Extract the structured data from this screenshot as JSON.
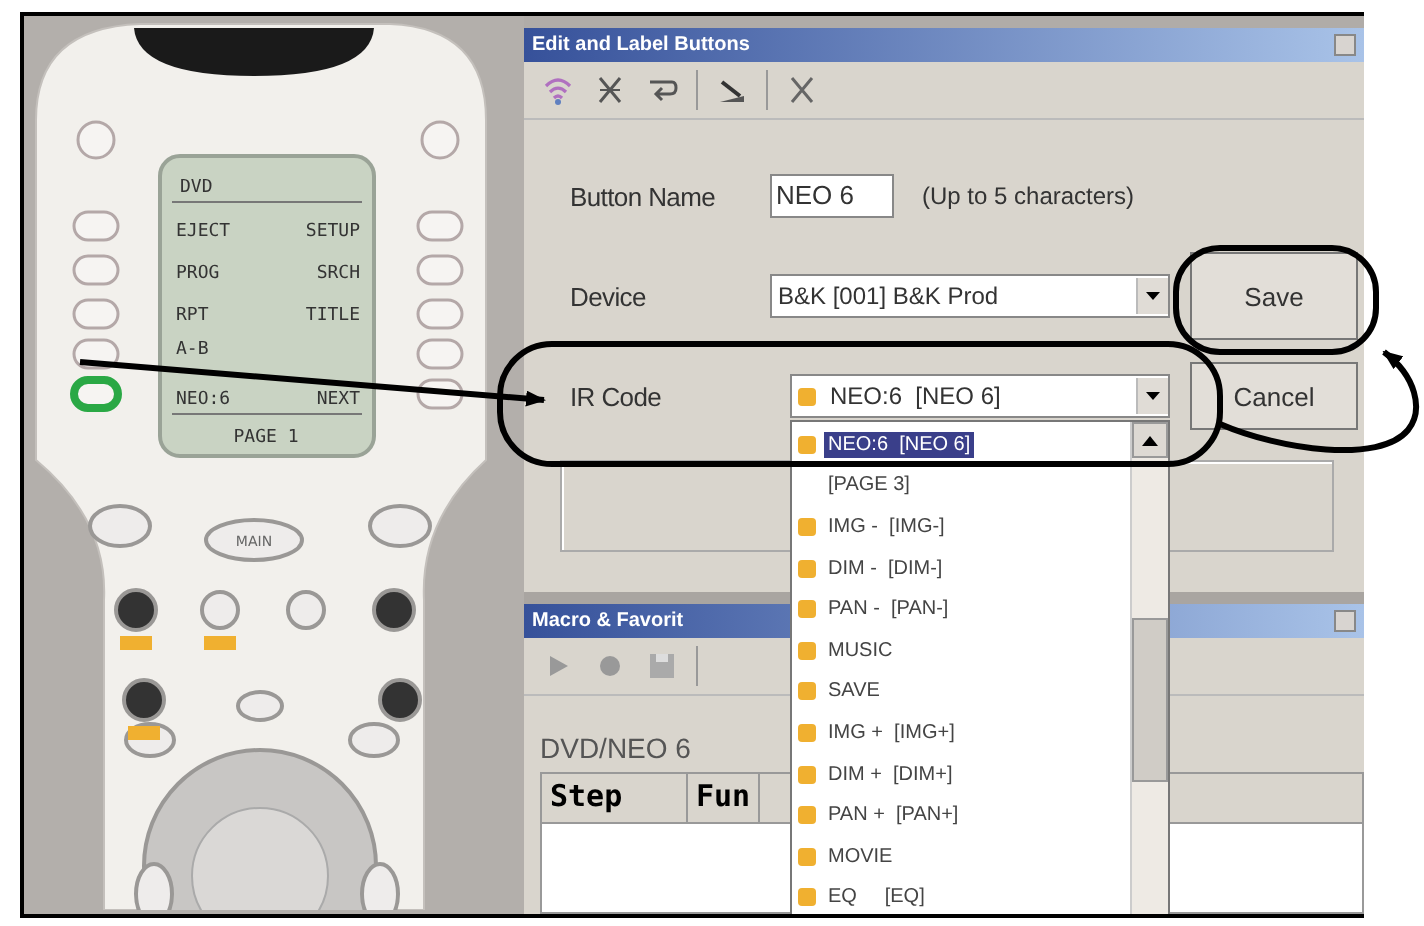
{
  "remote": {
    "lcd": {
      "title": "DVD",
      "rows": [
        {
          "left": "EJECT",
          "right": "SETUP"
        },
        {
          "left": "PROG",
          "right": "SRCH"
        },
        {
          "left": "RPT",
          "right": "TITLE"
        },
        {
          "left": "A-B"
        },
        {
          "left": "NEO:6",
          "right": "NEXT"
        }
      ],
      "footer": "PAGE 1"
    },
    "left_buttons": [
      {
        "selected": false
      },
      {
        "selected": false
      },
      {
        "selected": false
      },
      {
        "selected": false
      },
      {
        "selected": false
      },
      {
        "selected": true
      }
    ],
    "right_buttons": [
      {
        "selected": false
      },
      {
        "selected": false
      },
      {
        "selected": false
      },
      {
        "selected": false
      },
      {
        "selected": false
      },
      {
        "selected": false
      }
    ],
    "main_button": "MAIN"
  },
  "edit_window": {
    "title": "Edit and Label Buttons",
    "button_name": {
      "label": "Button Name",
      "value": "NEO 6",
      "hint": "(Up to 5 characters)"
    },
    "device": {
      "label": "Device",
      "value": "B&K [001] B&K Prod"
    },
    "ir_code": {
      "label": "IR Code",
      "value": "NEO:6  [NEO 6]"
    },
    "buttons": [
      "Save",
      "Cancel"
    ]
  },
  "ir_code_list": {
    "items": [
      {
        "kind": "code",
        "text": "NEO:6  [NEO 6]",
        "selected": true
      },
      {
        "kind": "page",
        "text": "[PAGE 3]",
        "selected": false
      },
      {
        "kind": "code",
        "text": "IMG -  [IMG-]",
        "selected": false
      },
      {
        "kind": "code",
        "text": "DIM -  [DIM-]",
        "selected": false
      },
      {
        "kind": "code",
        "text": "PAN -  [PAN-]",
        "selected": false
      },
      {
        "kind": "code",
        "text": "MUSIC",
        "selected": false
      },
      {
        "kind": "code",
        "text": "SAVE",
        "selected": false
      },
      {
        "kind": "code",
        "text": "IMG +  [IMG+]",
        "selected": false
      },
      {
        "kind": "code",
        "text": "DIM +  [DIM+]",
        "selected": false
      },
      {
        "kind": "code",
        "text": "PAN +  [PAN+]",
        "selected": false
      },
      {
        "kind": "code",
        "text": "MOVIE",
        "selected": false
      },
      {
        "kind": "code",
        "text": "EQ     [EQ]",
        "selected": false
      }
    ]
  },
  "macro_window": {
    "title": "Macro & Favorit",
    "path": "DVD/NEO 6",
    "columns": [
      "Step",
      "Fun"
    ]
  }
}
